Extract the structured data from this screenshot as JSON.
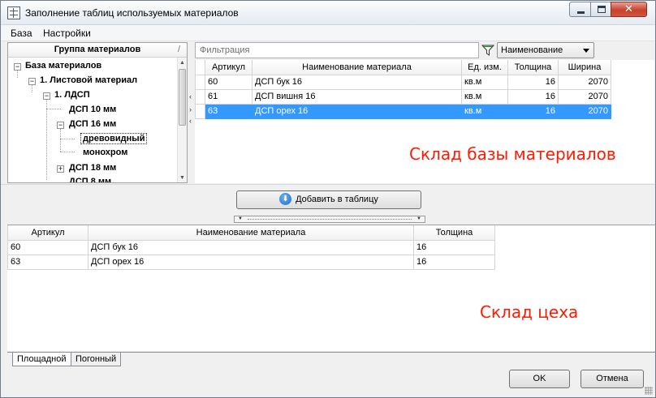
{
  "window": {
    "title": "Заполнение таблиц используемых материалов",
    "min_glyph": "",
    "max_glyph": "",
    "close_glyph": "✕"
  },
  "menu": {
    "items": [
      {
        "label": "База"
      },
      {
        "label": "Настройки"
      }
    ]
  },
  "tree": {
    "header": "Группа материалов",
    "sort_mark": "/",
    "nodes": [
      {
        "label": "База материалов",
        "toggle": "−"
      },
      {
        "label": "1. Листовой материал",
        "toggle": "−"
      },
      {
        "label": "1. ЛДСП",
        "toggle": "−"
      },
      {
        "label": "ДСП 10 мм",
        "toggle": ""
      },
      {
        "label": "ДСП 16 мм",
        "toggle": "−"
      },
      {
        "label": "древовидный",
        "toggle": ""
      },
      {
        "label": "монохром",
        "toggle": ""
      },
      {
        "label": "ДСП 18 мм",
        "toggle": "+"
      },
      {
        "label": "ДСП 8 мм",
        "toggle": ""
      }
    ],
    "selected_index": 5
  },
  "filter": {
    "placeholder": "Фильтрация",
    "field_combo": "Наименование"
  },
  "top_grid": {
    "headers": [
      "Артикул",
      "Наименование материала",
      "Ед. изм.",
      "Толщина",
      "Ширина"
    ],
    "rows": [
      {
        "article": "60",
        "name": "ДСП бук 16",
        "unit": "кв.м",
        "thickness": "16",
        "width": "2070",
        "selected": false
      },
      {
        "article": "61",
        "name": "ДСП вишня 16",
        "unit": "кв.м",
        "thickness": "16",
        "width": "2070",
        "selected": false
      },
      {
        "article": "63",
        "name": "ДСП орех 16",
        "unit": "кв.м",
        "thickness": "16",
        "width": "2070",
        "selected": true
      }
    ],
    "annotation": "Склад базы материалов"
  },
  "add_button": {
    "label": "Добавить в таблицу",
    "icon": "arrow-down-circle-icon"
  },
  "bottom_grid": {
    "headers": [
      "Артикул",
      "Наименование материала",
      "Толщина"
    ],
    "rows": [
      {
        "article": "60",
        "name": "ДСП бук 16",
        "thickness": "16"
      },
      {
        "article": "63",
        "name": "ДСП орех 16",
        "thickness": "16"
      }
    ],
    "annotation": "Склад цеха"
  },
  "tabs": [
    {
      "label": "Площадной",
      "active": true
    },
    {
      "label": "Погонный",
      "active": false
    }
  ],
  "buttons": {
    "ok": "OK",
    "cancel": "Отмена"
  },
  "colors": {
    "selection": "#3399ff",
    "annotation": "#ff1a00",
    "close_button": "#c7412c"
  }
}
